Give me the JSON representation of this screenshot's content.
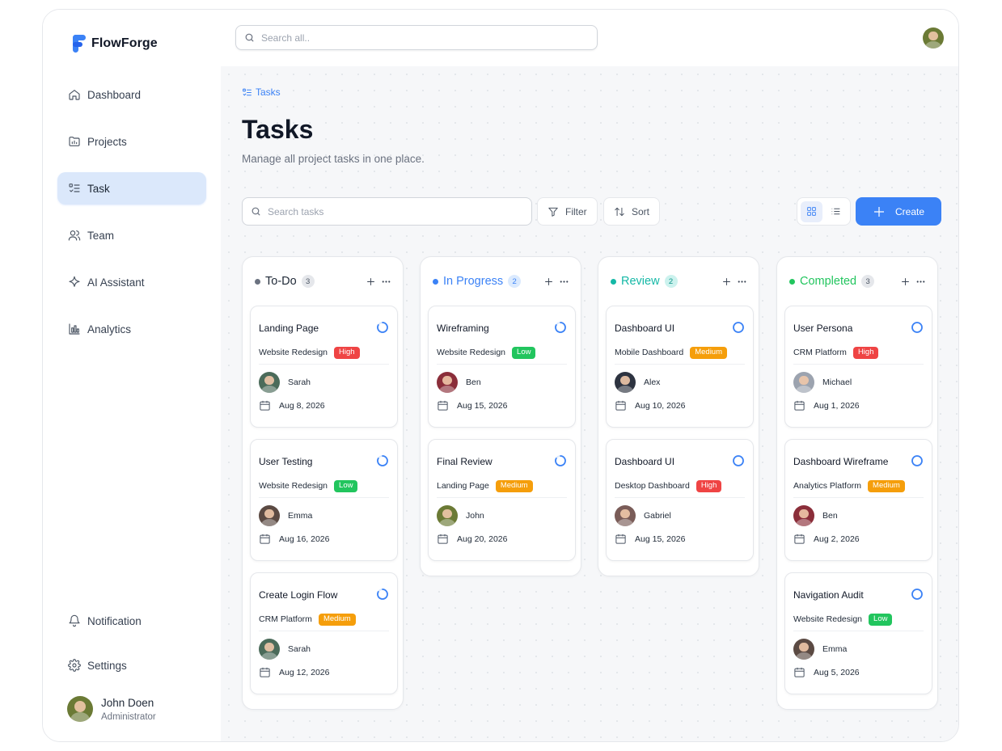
{
  "app": {
    "name": "FlowForge"
  },
  "colors": {
    "accent": "#3b82f6",
    "high": "#ef4444",
    "medium": "#f59e0b",
    "low": "#22c55e"
  },
  "topbar": {
    "search_placeholder": "Search all.."
  },
  "sidebar": {
    "items": [
      {
        "label": "Dashboard",
        "icon": "home-icon",
        "active": false
      },
      {
        "label": "Projects",
        "icon": "folder-chart-icon",
        "active": false
      },
      {
        "label": "Task",
        "icon": "task-list-icon",
        "active": true
      },
      {
        "label": "Team",
        "icon": "users-icon",
        "active": false
      },
      {
        "label": "AI Assistant",
        "icon": "sparkle-icon",
        "active": false
      },
      {
        "label": "Analytics",
        "icon": "bar-chart-icon",
        "active": false
      }
    ],
    "bottom": [
      {
        "label": "Notification",
        "icon": "bell-icon"
      },
      {
        "label": "Settings",
        "icon": "gear-icon"
      }
    ],
    "user": {
      "name": "John Doen",
      "role": "Administrator"
    }
  },
  "page": {
    "breadcrumb": "Tasks",
    "title": "Tasks",
    "subtitle": "Manage all project tasks in one place."
  },
  "toolbar": {
    "search_placeholder": "Search tasks",
    "filter_label": "Filter",
    "sort_label": "Sort",
    "create_label": "Create"
  },
  "columns": [
    {
      "title": "To-Do",
      "count": "3",
      "dot": "#6b7280",
      "title_color": "#1f2937",
      "count_bg": "#e5e7eb",
      "count_color": "#4b5563",
      "status": "spinner",
      "cards": [
        {
          "title": "Landing Page",
          "project": "Website Redesign",
          "priority": "High",
          "assignee": "Sarah",
          "date": "Aug 8, 2026",
          "avatar_color": "#4b6b5a"
        },
        {
          "title": "User Testing",
          "project": "Website Redesign",
          "priority": "Low",
          "assignee": "Emma",
          "date": "Aug 16, 2026",
          "avatar_color": "#5b4a43"
        },
        {
          "title": "Create Login Flow",
          "project": "CRM Platform",
          "priority": "Medium",
          "assignee": "Sarah",
          "date": "Aug 12, 2026",
          "avatar_color": "#4b6b5a"
        }
      ]
    },
    {
      "title": "In Progress",
      "count": "2",
      "dot": "#3b82f6",
      "title_color": "#3b82f6",
      "count_bg": "#dbeafe",
      "count_color": "#3b82f6",
      "status": "spinner",
      "cards": [
        {
          "title": "Wireframing",
          "project": "Website Redesign",
          "priority": "Low",
          "assignee": "Ben",
          "date": "Aug 15, 2026",
          "avatar_color": "#8b2e3a"
        },
        {
          "title": "Final Review",
          "project": "Landing Page",
          "priority": "Medium",
          "assignee": "John",
          "date": "Aug 20, 2026",
          "avatar_color": "#6b7a35"
        }
      ]
    },
    {
      "title": "Review",
      "count": "2",
      "dot": "#14b8a6",
      "title_color": "#14b8a6",
      "count_bg": "#ccf2ee",
      "count_color": "#0f9488",
      "status": "ring",
      "cards": [
        {
          "title": "Dashboard UI",
          "project": "Mobile Dashboard",
          "priority": "Medium",
          "assignee": "Alex",
          "date": "Aug 10, 2026",
          "avatar_color": "#2d3340"
        },
        {
          "title": "Dashboard UI",
          "project": "Desktop Dashboard",
          "priority": "High",
          "assignee": "Gabriel",
          "date": "Aug 15, 2026",
          "avatar_color": "#7a5c58"
        }
      ]
    },
    {
      "title": "Completed",
      "count": "3",
      "dot": "#22c55e",
      "title_color": "#22c55e",
      "count_bg": "#e5e7eb",
      "count_color": "#4b5563",
      "status": "ring",
      "cards": [
        {
          "title": "User Persona",
          "project": "CRM Platform",
          "priority": "High",
          "assignee": "Michael",
          "date": "Aug 1, 2026",
          "avatar_color": "#9ca3af"
        },
        {
          "title": "Dashboard Wireframe",
          "project": "Analytics Platform",
          "priority": "Medium",
          "assignee": "Ben",
          "date": "Aug 2, 2026",
          "avatar_color": "#8b2e3a"
        },
        {
          "title": "Navigation Audit",
          "project": "Website Redesign",
          "priority": "Low",
          "assignee": "Emma",
          "date": "Aug 5, 2026",
          "avatar_color": "#5b4a43"
        }
      ]
    }
  ]
}
